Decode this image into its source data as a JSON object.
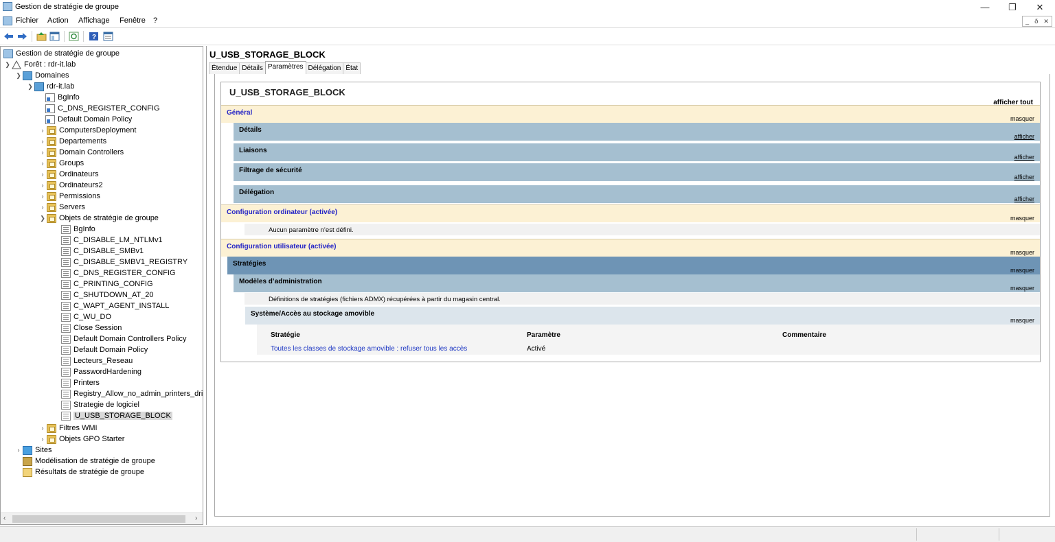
{
  "window": {
    "title": "Gestion de stratégie de groupe",
    "min_glyph": "—",
    "max_glyph": "❐",
    "close_glyph": "✕"
  },
  "menu": {
    "items": [
      "Fichier",
      "Action",
      "Affichage",
      "Fenêtre",
      "?"
    ],
    "mdi": [
      "_",
      "ð",
      "✕"
    ]
  },
  "toolbar": {
    "icons": [
      "back-arrow-icon",
      "forward-arrow-icon",
      "up-folder-icon",
      "show-hide-tree-icon",
      "refresh-icon",
      "help-icon",
      "properties-icon"
    ]
  },
  "tree": {
    "root": "Gestion de stratégie de groupe",
    "forest": "Forêt : rdr-it.lab",
    "domains": "Domaines",
    "domain": "rdr-it.lab",
    "linked_gpos": [
      "BgInfo",
      "C_DNS_REGISTER_CONFIG",
      "Default Domain Policy"
    ],
    "ous": [
      "ComputersDeployment",
      "Departements",
      "Domain Controllers",
      "Groups",
      "Ordinateurs",
      "Ordinateurs2",
      "Permissions",
      "Servers"
    ],
    "gpo_container": "Objets de stratégie de groupe",
    "gpos": [
      "BgInfo",
      "C_DISABLE_LM_NTLMv1",
      "C_DISABLE_SMBv1",
      "C_DISABLE_SMBV1_REGISTRY",
      "C_DNS_REGISTER_CONFIG",
      "C_PRINTING_CONFIG",
      "C_SHUTDOWN_AT_20",
      "C_WAPT_AGENT_INSTALL",
      "C_WU_DO",
      "Close Session",
      "Default Domain Controllers Policy",
      "Default Domain Policy",
      "Lecteurs_Reseau",
      "PasswordHardening",
      "Printers",
      "Registry_Allow_no_admin_printers_drive",
      "Strategie de logiciel",
      "U_USB_STORAGE_BLOCK"
    ],
    "wmi": "Filtres WMI",
    "starter": "Objets GPO Starter",
    "sites": "Sites",
    "modeling": "Modélisation de stratégie de groupe",
    "results": "Résultats de stratégie de groupe"
  },
  "detail": {
    "gpo_name": "U_USB_STORAGE_BLOCK",
    "tabs": [
      "Étendue",
      "Détails",
      "Paramètres",
      "Délégation",
      "État"
    ],
    "active_tab": "Paramètres",
    "report": {
      "title": "U_USB_STORAGE_BLOCK",
      "show_all": "afficher tout",
      "general": "Général",
      "hide": "masquer",
      "show": "afficher",
      "details": "Détails",
      "links": "Liaisons",
      "security_filtering": "Filtrage de sécurité",
      "delegation": "Délégation",
      "computer_config": "Configuration ordinateur (activée)",
      "no_settings": "Aucun paramètre n’est défini.",
      "user_config": "Configuration utilisateur (activée)",
      "policies": "Stratégies",
      "admin_templates": "Modèles d’administration",
      "admx_note": "Définitions de stratégies (fichiers ADMX) récupérées à partir du magasin central.",
      "system_path": "Système/Accès au stockage amovible",
      "table_headers": [
        "Stratégie",
        "Paramètre",
        "Commentaire"
      ],
      "policy_name": "Toutes les classes de stockage amovible : refuser tous les accès",
      "policy_value": "Activé"
    }
  },
  "colors": {
    "general_band": "#fcf1d4",
    "sub_band": "#a5bfd0",
    "strategies_band": "#6e94b5",
    "system_band": "#dce5ec",
    "link_blue": "#2424c6"
  }
}
